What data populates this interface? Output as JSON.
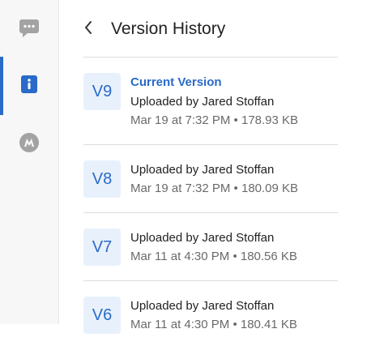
{
  "sidebar": {
    "items": [
      {
        "name": "comments",
        "icon": "chat-bubble-icon",
        "active": false
      },
      {
        "name": "details",
        "icon": "info-icon",
        "active": true
      },
      {
        "name": "activity",
        "icon": "m-logo-icon",
        "active": false
      }
    ]
  },
  "header": {
    "title": "Version History"
  },
  "versions": [
    {
      "label": "V9",
      "current_label": "Current Version",
      "uploader": "Uploaded by Jared Stoffan",
      "meta": "Mar 19 at 7:32 PM • 178.93 KB"
    },
    {
      "label": "V8",
      "uploader": "Uploaded by Jared Stoffan",
      "meta": "Mar 19 at 7:32 PM • 180.09 KB"
    },
    {
      "label": "V7",
      "uploader": "Uploaded by Jared Stoffan",
      "meta": "Mar 11 at 4:30 PM • 180.56 KB"
    },
    {
      "label": "V6",
      "uploader": "Uploaded by Jared Stoffan",
      "meta": "Mar 11 at 4:30 PM • 180.41 KB"
    }
  ],
  "colors": {
    "accent": "#2a6ac9",
    "badge_bg": "#e8f1fb",
    "icon_gray": "#a3a3a3"
  }
}
